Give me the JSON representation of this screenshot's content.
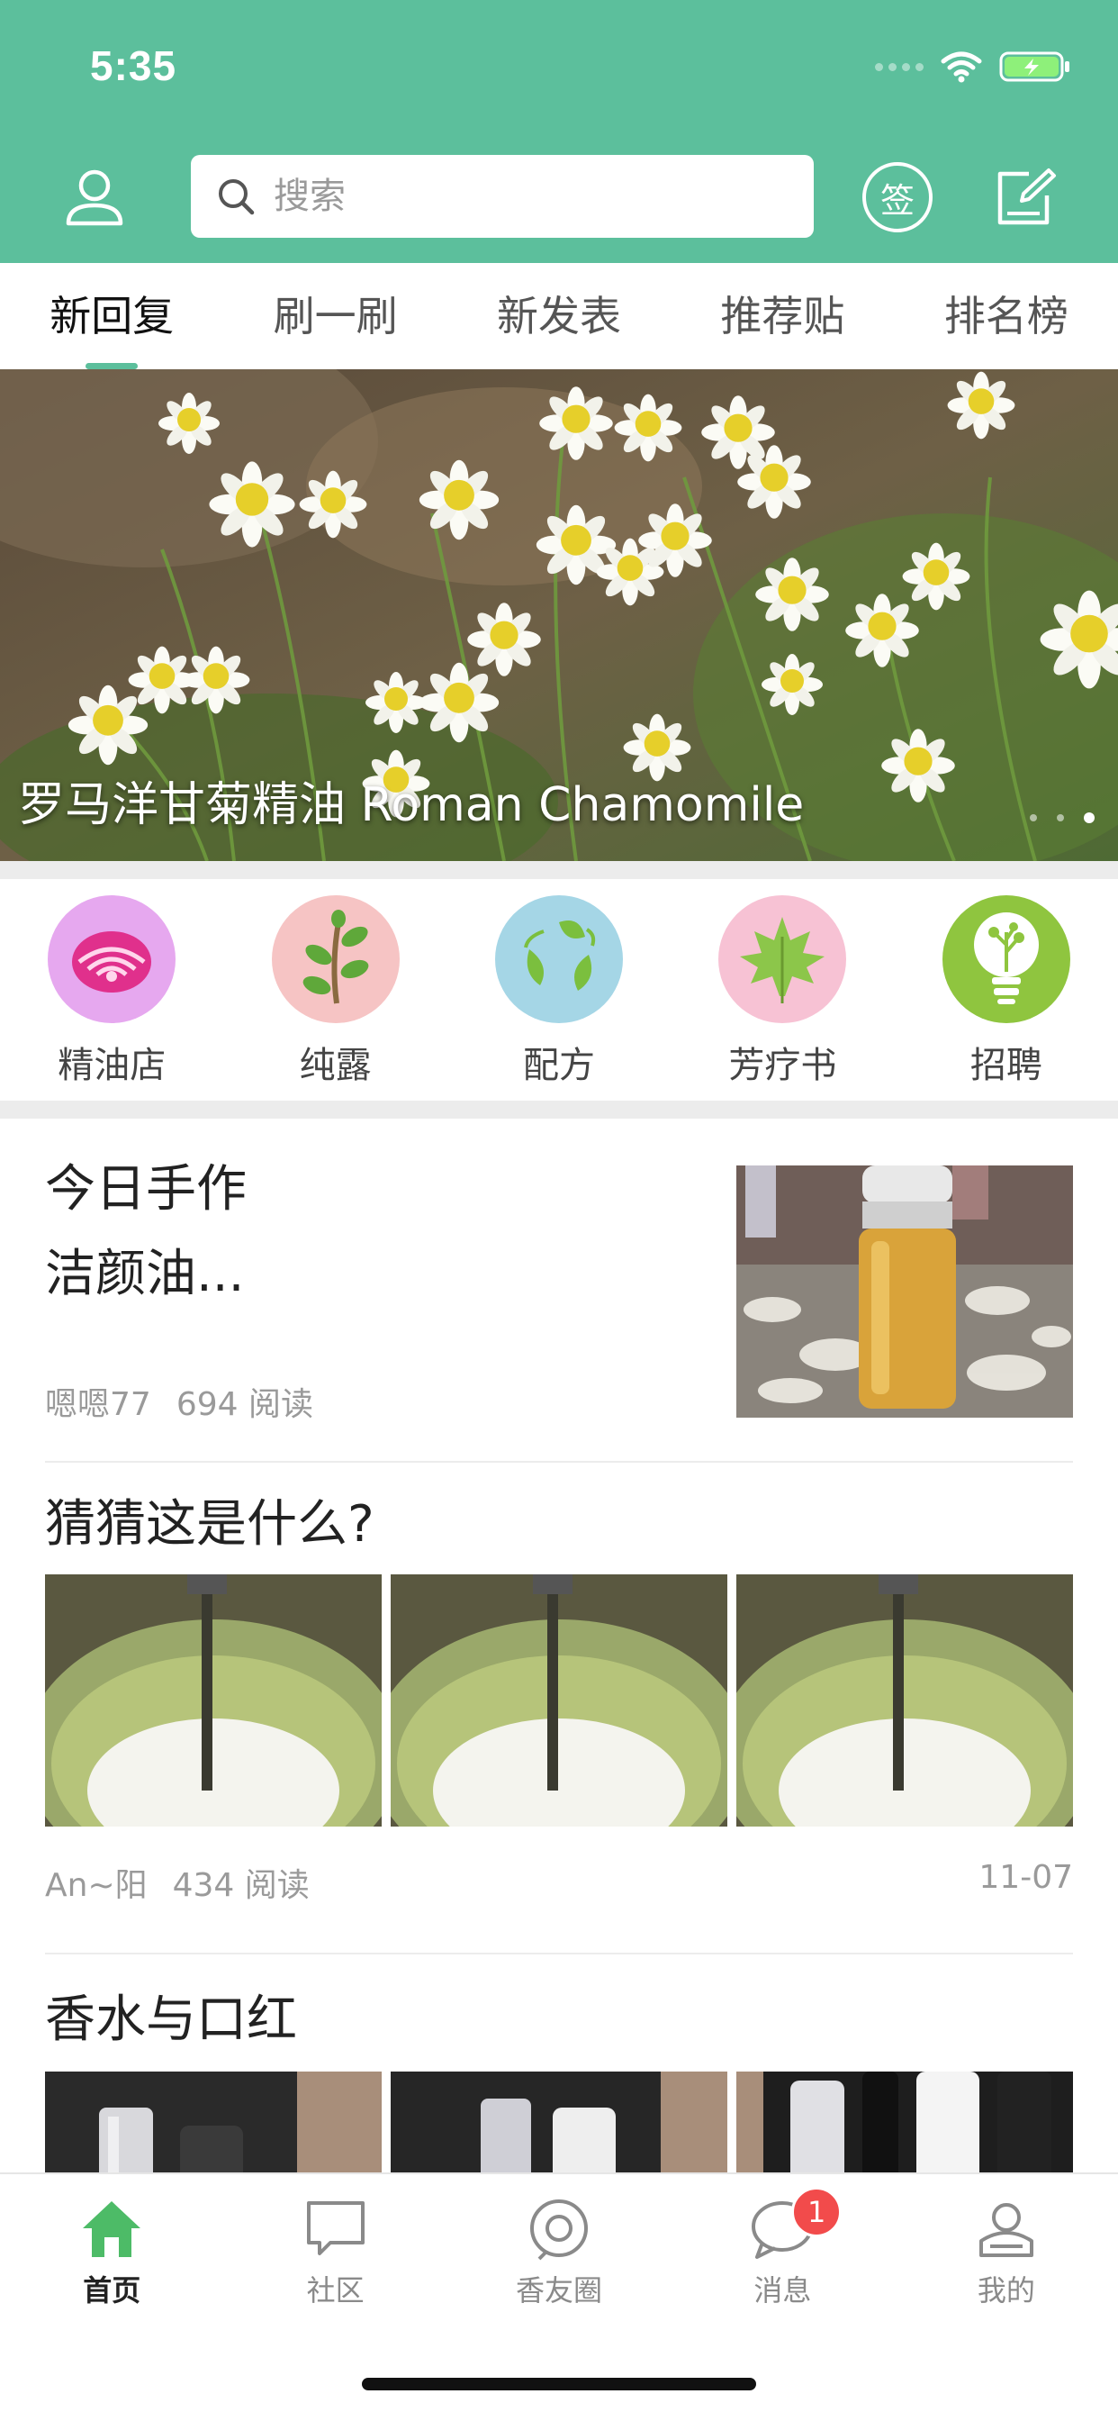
{
  "status_bar": {
    "time": "5:35"
  },
  "header": {
    "search_placeholder": "搜索",
    "sign_in_label": "签",
    "icons": {
      "profile": "user-icon",
      "search": "search-icon",
      "sign_in": "sign-in-icon",
      "compose": "compose-icon"
    }
  },
  "tabs": [
    {
      "label": "新回复",
      "active": true
    },
    {
      "label": "刷一刷"
    },
    {
      "label": "新发表"
    },
    {
      "label": "推荐贴"
    },
    {
      "label": "排名榜"
    }
  ],
  "banner": {
    "caption": "罗马洋甘菊精油 Roman Chamomile",
    "page_count": 3,
    "active_page": 3
  },
  "categories": [
    {
      "label": "精油店",
      "icon": "rose-icon",
      "color": "#e6a8ef"
    },
    {
      "label": "纯露",
      "icon": "sprout-icon",
      "color": "#f6c4c4"
    },
    {
      "label": "配方",
      "icon": "leaves-icon",
      "color": "#a5d6e6"
    },
    {
      "label": "芳疗书",
      "icon": "maple-leaf-icon",
      "color": "#f7c2d4"
    },
    {
      "label": "招聘",
      "icon": "lightbulb-icon",
      "color": "#8fc53f"
    }
  ],
  "feed": [
    {
      "title_line1": "今日手作",
      "title_line2": "洁颜油...",
      "author": "嗯嗯77",
      "reads": "694 阅读"
    },
    {
      "title": "猜猜这是什么?",
      "author": "An~阳",
      "reads": "434 阅读",
      "date": "11-07"
    },
    {
      "title": "香水与口红"
    }
  ],
  "bottom_nav": [
    {
      "label": "首页",
      "icon": "home-icon",
      "active": true
    },
    {
      "label": "社区",
      "icon": "chat-square-icon"
    },
    {
      "label": "香友圈",
      "icon": "circle-icon"
    },
    {
      "label": "消息",
      "icon": "message-icon",
      "badge": "1"
    },
    {
      "label": "我的",
      "icon": "profile-icon"
    }
  ],
  "colors": {
    "brand_green": "#5cbf9c",
    "badge_red": "#f24b4b"
  }
}
